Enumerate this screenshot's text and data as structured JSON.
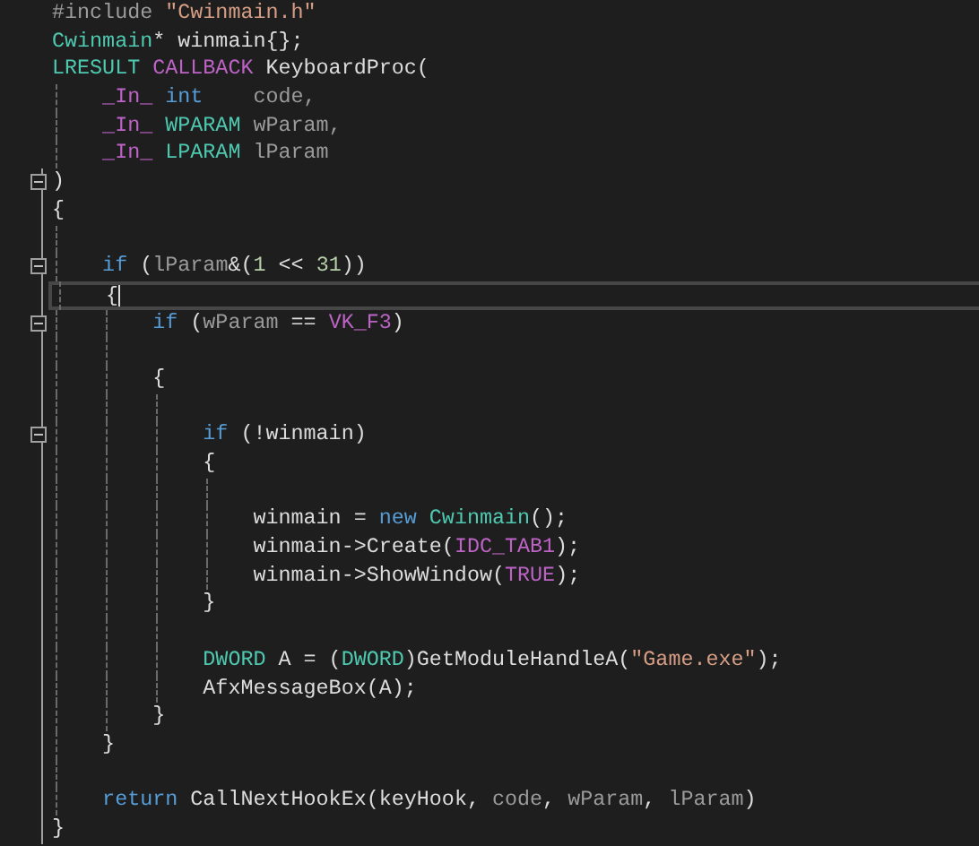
{
  "editor": {
    "lines": [
      {
        "fold": false,
        "current": false,
        "tokens": [
          {
            "kind": "pre",
            "text": "#include "
          },
          {
            "kind": "str",
            "text": "\"Cwinmain.h\""
          }
        ]
      },
      {
        "fold": false,
        "current": false,
        "tokens": [
          {
            "kind": "type",
            "text": "Cwinmain"
          },
          {
            "kind": "plain",
            "text": "* winmain{};"
          }
        ]
      },
      {
        "fold": false,
        "current": false,
        "tokens": [
          {
            "kind": "type",
            "text": "LRESULT "
          },
          {
            "kind": "macro",
            "text": "CALLBACK"
          },
          {
            "kind": "plain",
            "text": " KeyboardProc("
          }
        ]
      },
      {
        "fold": false,
        "current": false,
        "tokens": [
          {
            "kind": "macro",
            "text": "    _In_ "
          },
          {
            "kind": "kw",
            "text": "int"
          },
          {
            "kind": "param",
            "text": "    code,"
          }
        ]
      },
      {
        "fold": false,
        "current": false,
        "tokens": [
          {
            "kind": "macro",
            "text": "    _In_ "
          },
          {
            "kind": "type",
            "text": "WPARAM"
          },
          {
            "kind": "param",
            "text": " wParam,"
          }
        ]
      },
      {
        "fold": false,
        "current": false,
        "tokens": [
          {
            "kind": "macro",
            "text": "    _In_ "
          },
          {
            "kind": "type",
            "text": "LPARAM"
          },
          {
            "kind": "param",
            "text": " lParam"
          }
        ]
      },
      {
        "fold": true,
        "current": false,
        "tokens": [
          {
            "kind": "plain",
            "text": ")"
          }
        ]
      },
      {
        "fold": false,
        "current": false,
        "tokens": [
          {
            "kind": "plain",
            "text": "{"
          }
        ]
      },
      {
        "fold": false,
        "current": false
      },
      {
        "fold": true,
        "current": false,
        "tokens": [
          {
            "kind": "kw",
            "text": "    if"
          },
          {
            "kind": "plain",
            "text": " ("
          },
          {
            "kind": "param",
            "text": "lParam"
          },
          {
            "kind": "plain",
            "text": "&("
          },
          {
            "kind": "num",
            "text": "1"
          },
          {
            "kind": "plain",
            "text": " << "
          },
          {
            "kind": "num",
            "text": "31"
          },
          {
            "kind": "plain",
            "text": "))"
          }
        ]
      },
      {
        "fold": false,
        "current": true,
        "tokens": [
          {
            "kind": "plain",
            "text": "    {"
          }
        ]
      },
      {
        "fold": true,
        "current": false,
        "tokens": [
          {
            "kind": "kw",
            "text": "        if"
          },
          {
            "kind": "plain",
            "text": " ("
          },
          {
            "kind": "param",
            "text": "wParam"
          },
          {
            "kind": "plain",
            "text": " == "
          },
          {
            "kind": "macro",
            "text": "VK_F3"
          },
          {
            "kind": "plain",
            "text": ")"
          }
        ]
      },
      {
        "fold": false,
        "current": false
      },
      {
        "fold": false,
        "current": false,
        "tokens": [
          {
            "kind": "plain",
            "text": "        {"
          }
        ]
      },
      {
        "fold": false,
        "current": false
      },
      {
        "fold": true,
        "current": false,
        "tokens": [
          {
            "kind": "kw",
            "text": "            if"
          },
          {
            "kind": "plain",
            "text": " (!winmain)"
          }
        ]
      },
      {
        "fold": false,
        "current": false,
        "tokens": [
          {
            "kind": "plain",
            "text": "            {"
          }
        ]
      },
      {
        "fold": false,
        "current": false
      },
      {
        "fold": false,
        "current": false,
        "tokens": [
          {
            "kind": "plain",
            "text": "                winmain = "
          },
          {
            "kind": "kw",
            "text": "new "
          },
          {
            "kind": "type",
            "text": "Cwinmain"
          },
          {
            "kind": "plain",
            "text": "();"
          }
        ]
      },
      {
        "fold": false,
        "current": false,
        "tokens": [
          {
            "kind": "plain",
            "text": "                winmain->Create("
          },
          {
            "kind": "macro",
            "text": "IDC_TAB1"
          },
          {
            "kind": "plain",
            "text": ");"
          }
        ]
      },
      {
        "fold": false,
        "current": false,
        "tokens": [
          {
            "kind": "plain",
            "text": "                winmain->ShowWindow("
          },
          {
            "kind": "macro",
            "text": "TRUE"
          },
          {
            "kind": "plain",
            "text": ");"
          }
        ]
      },
      {
        "fold": false,
        "current": false,
        "tokens": [
          {
            "kind": "plain",
            "text": "            }"
          }
        ]
      },
      {
        "fold": false,
        "current": false
      },
      {
        "fold": false,
        "current": false,
        "tokens": [
          {
            "kind": "type",
            "text": "            DWORD"
          },
          {
            "kind": "plain",
            "text": " A = ("
          },
          {
            "kind": "type",
            "text": "DWORD"
          },
          {
            "kind": "plain",
            "text": ")GetModuleHandleA("
          },
          {
            "kind": "str",
            "text": "\"Game.exe\""
          },
          {
            "kind": "plain",
            "text": ");"
          }
        ]
      },
      {
        "fold": false,
        "current": false,
        "tokens": [
          {
            "kind": "plain",
            "text": "            AfxMessageBox(A);"
          }
        ]
      },
      {
        "fold": false,
        "current": false,
        "tokens": [
          {
            "kind": "plain",
            "text": "        }"
          }
        ]
      },
      {
        "fold": false,
        "current": false,
        "tokens": [
          {
            "kind": "plain",
            "text": "    }"
          }
        ]
      },
      {
        "fold": false,
        "current": false
      },
      {
        "fold": false,
        "current": false,
        "tokens": [
          {
            "kind": "kw",
            "text": "    return"
          },
          {
            "kind": "plain",
            "text": " CallNextHookEx(keyHook, "
          },
          {
            "kind": "param",
            "text": "code"
          },
          {
            "kind": "plain",
            "text": ", "
          },
          {
            "kind": "param",
            "text": "wParam"
          },
          {
            "kind": "plain",
            "text": ", "
          },
          {
            "kind": "param",
            "text": "lParam"
          },
          {
            "kind": "plain",
            "text": ")"
          }
        ]
      },
      {
        "fold": false,
        "current": false,
        "tokens": [
          {
            "kind": "plain",
            "text": "}"
          }
        ]
      }
    ]
  }
}
